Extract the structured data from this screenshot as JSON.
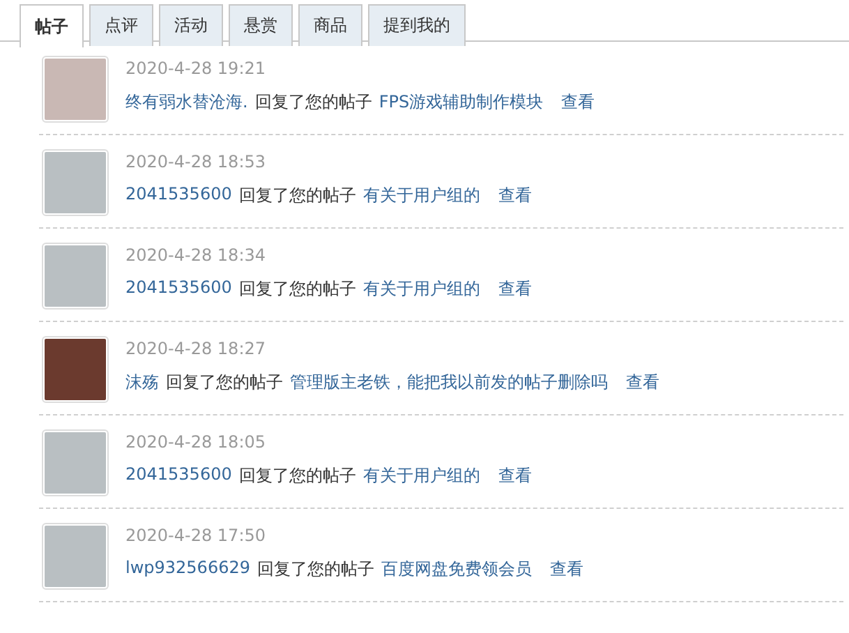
{
  "tabs": [
    {
      "label": "帖子",
      "selected": true
    },
    {
      "label": "点评",
      "selected": false
    },
    {
      "label": "活动",
      "selected": false
    },
    {
      "label": "悬赏",
      "selected": false
    },
    {
      "label": "商品",
      "selected": false
    },
    {
      "label": "提到我的",
      "selected": false
    }
  ],
  "notifications": [
    {
      "kind": "photo",
      "time": "2020-4-28 19:21",
      "user": "终有弱水替沧海.",
      "action": "回复了您的帖子",
      "thread": "FPS游戏辅助制作模块",
      "view": "查看"
    },
    {
      "kind": "cartoon",
      "time": "2020-4-28 18:53",
      "user": "2041535600",
      "action": "回复了您的帖子",
      "thread": "有关于用户组的",
      "view": "查看"
    },
    {
      "kind": "cartoon",
      "time": "2020-4-28 18:34",
      "user": "2041535600",
      "action": "回复了您的帖子",
      "thread": "有关于用户组的",
      "view": "查看"
    },
    {
      "kind": "illustration",
      "time": "2020-4-28 18:27",
      "user": "沫殇",
      "action": "回复了您的帖子",
      "thread": "管理版主老铁，能把我以前发的帖子删除吗",
      "view": "查看"
    },
    {
      "kind": "cartoon",
      "time": "2020-4-28 18:05",
      "user": "2041535600",
      "action": "回复了您的帖子",
      "thread": "有关于用户组的",
      "view": "查看"
    },
    {
      "kind": "cartoon",
      "time": "2020-4-28 17:50",
      "user": "lwp932566629",
      "action": "回复了您的帖子",
      "thread": "百度网盘免费领会员",
      "view": "查看"
    }
  ]
}
